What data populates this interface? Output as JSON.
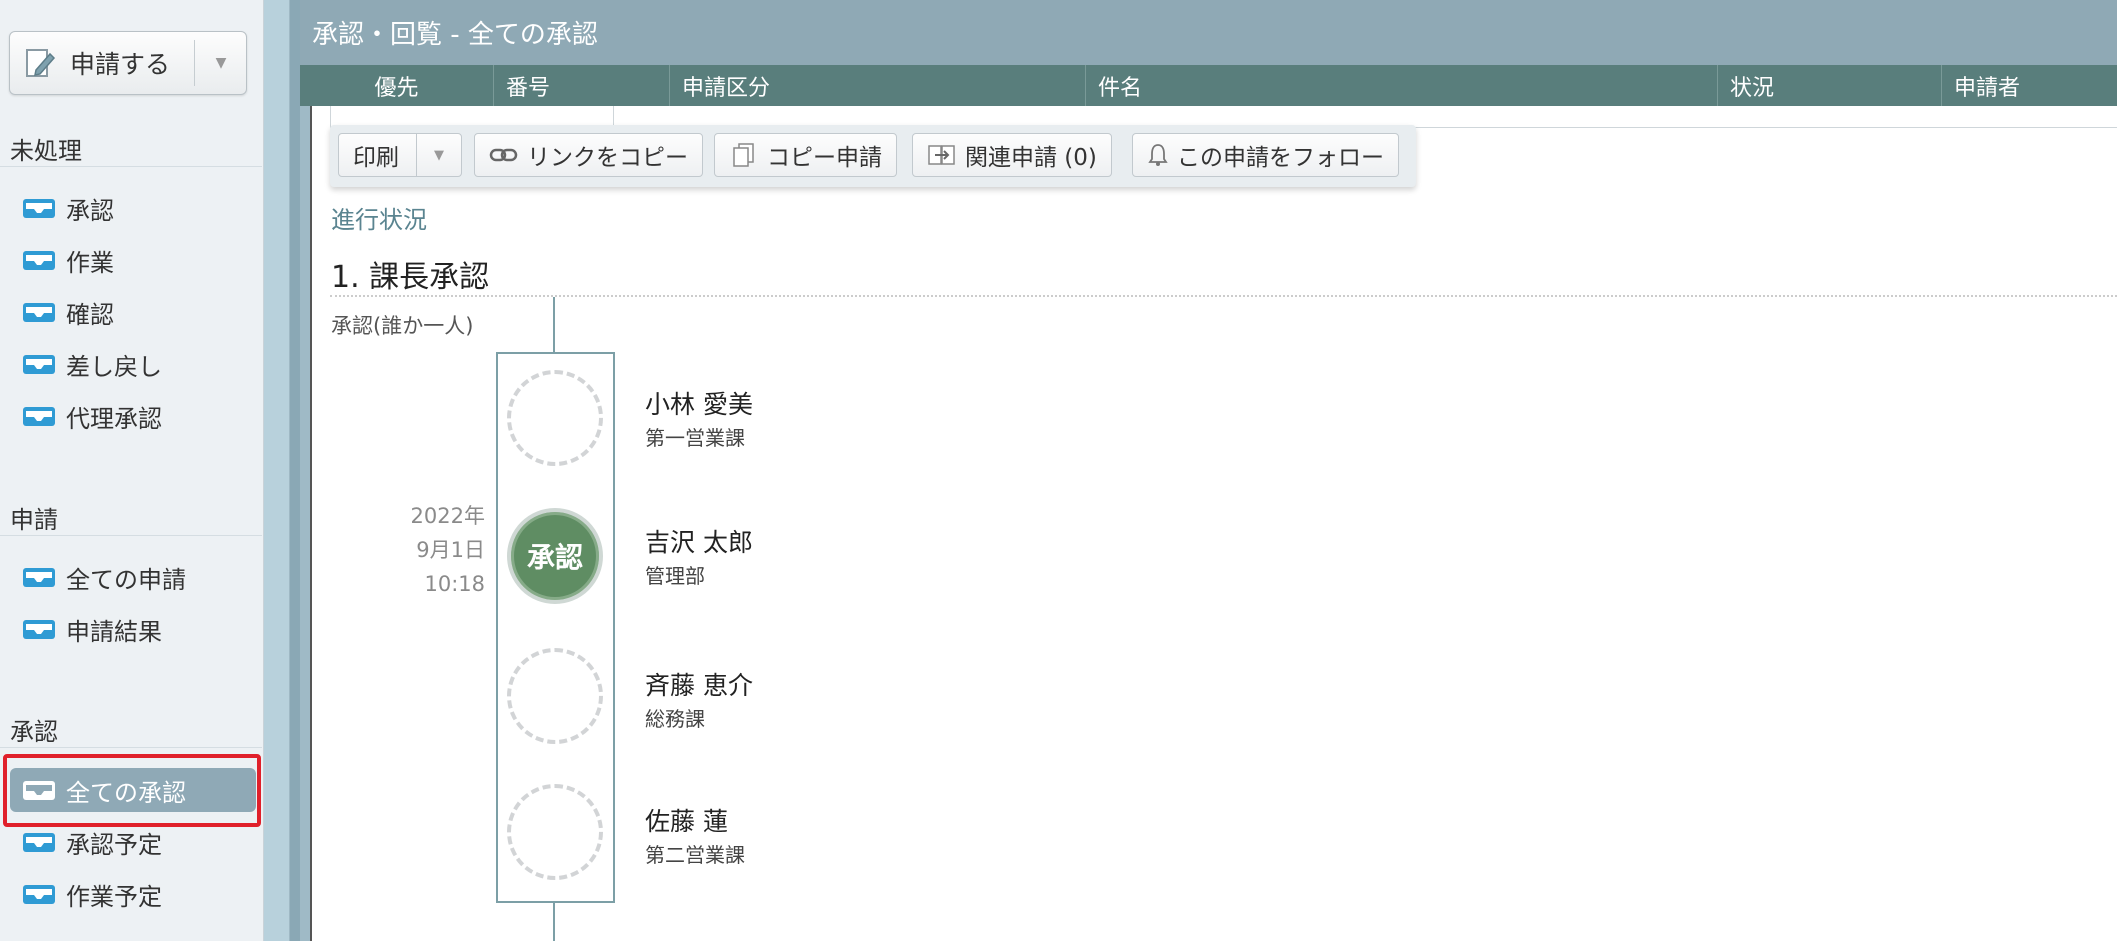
{
  "sidebar": {
    "apply_button": {
      "label": "申請する"
    },
    "sections": [
      {
        "title": "未処理",
        "items": [
          "承認",
          "作業",
          "確認",
          "差し戻し",
          "代理承認"
        ]
      },
      {
        "title": "申請",
        "items": [
          "全ての申請",
          "申請結果"
        ]
      },
      {
        "title": "承認",
        "items": [
          "全ての承認",
          "承認予定",
          "作業予定"
        ]
      }
    ],
    "active_item": "全ての承認"
  },
  "header": {
    "title": "承認・回覧 - 全ての承認",
    "columns": [
      "優先",
      "番号",
      "申請区分",
      "件名",
      "状況",
      "申請者"
    ]
  },
  "toolbar": {
    "print": "印刷",
    "copy_link": "リンクをコピー",
    "copy_apply": "コピー申請",
    "related": "関連申請 (0)",
    "follow": "この申請をフォロー"
  },
  "progress": {
    "label": "進行状況",
    "step_title": "1. 課長承認",
    "approval_type": "承認(誰か一人)",
    "stamp_label": "承認",
    "stamp_time": [
      "2022年",
      "9月1日",
      "10:18"
    ],
    "approvers": [
      {
        "name": "小林 愛美",
        "dept": "第一営業課",
        "status": "pending"
      },
      {
        "name": "吉沢 太郎",
        "dept": "管理部",
        "status": "approved"
      },
      {
        "name": "斉藤 恵介",
        "dept": "総務課",
        "status": "pending"
      },
      {
        "name": "佐藤 蓮",
        "dept": "第二営業課",
        "status": "pending"
      }
    ]
  },
  "colors": {
    "header_bg": "#8fa9b5",
    "columns_bg": "#597e7c",
    "active_nav": "#8fa9b6",
    "approved_stamp": "#5f8d63",
    "highlight": "#e0202b"
  }
}
